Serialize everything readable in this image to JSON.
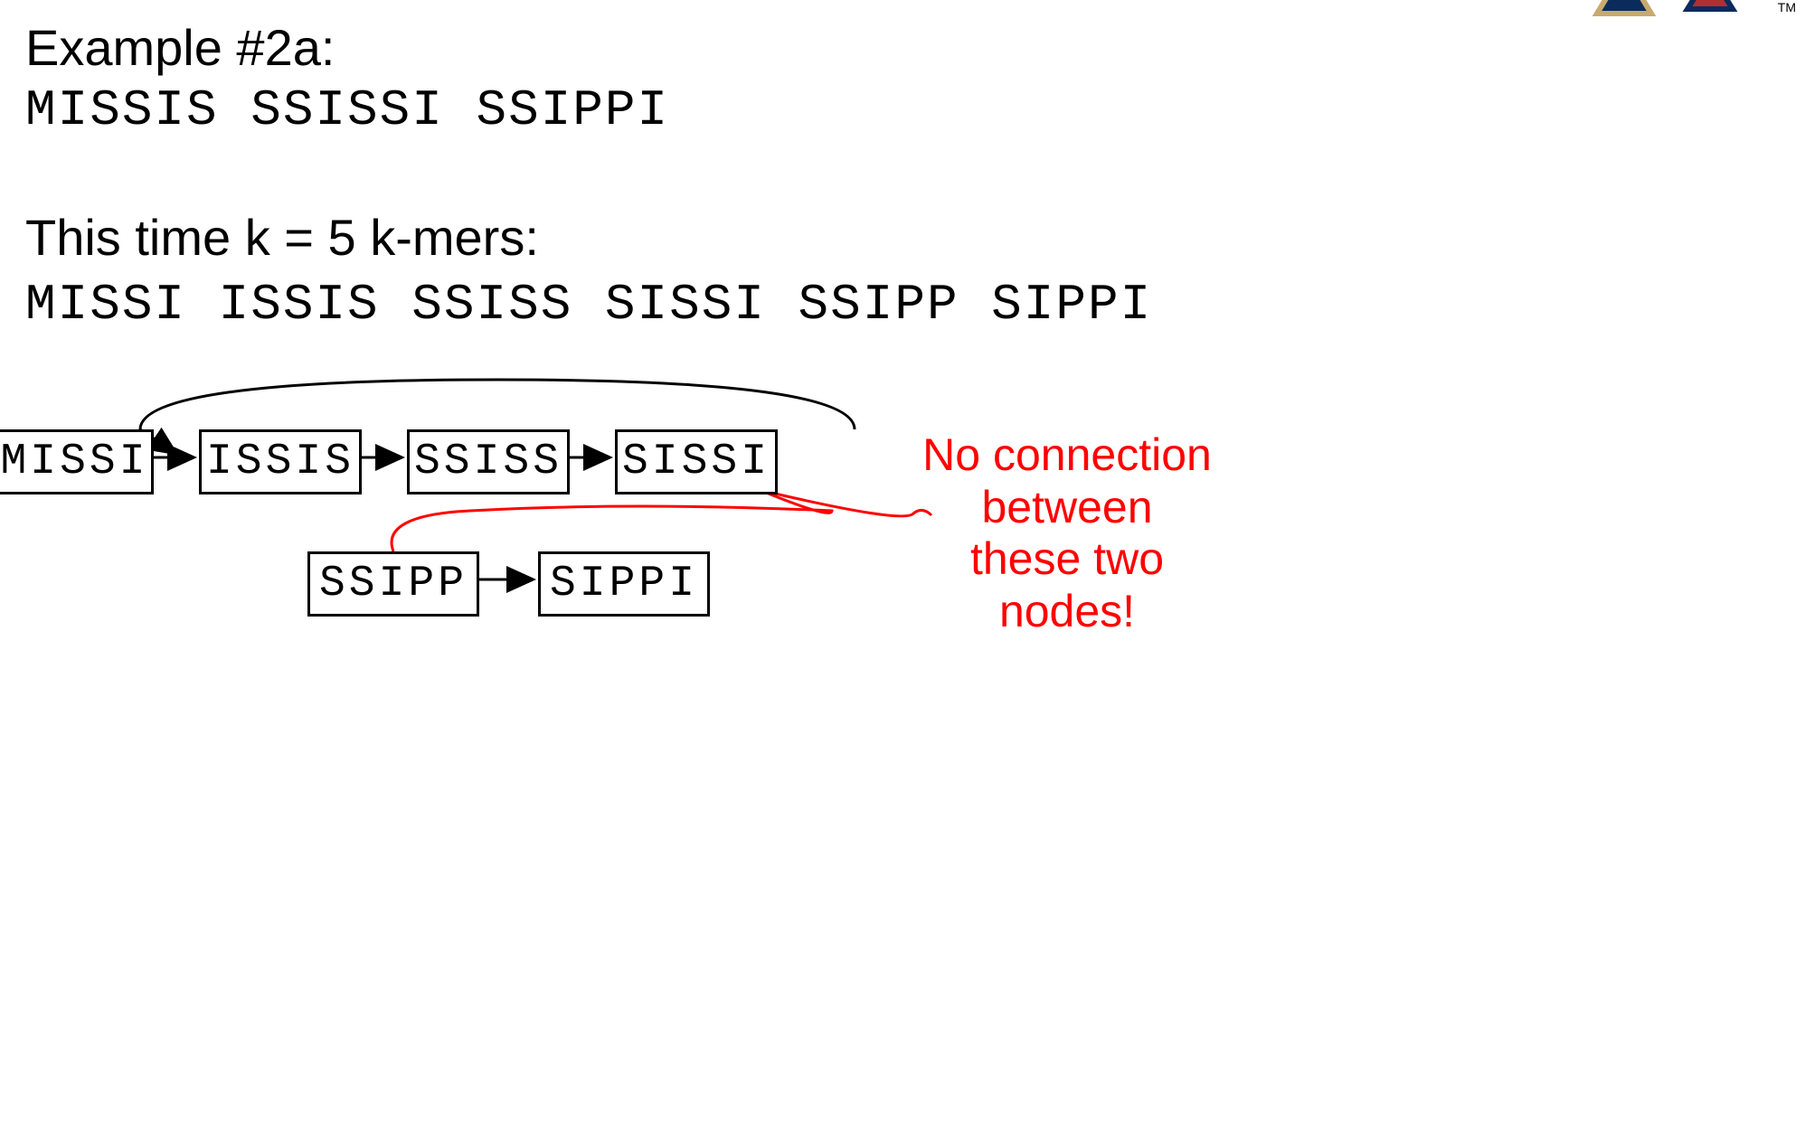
{
  "header": {
    "title": "Example #2a:",
    "sequence": "MISSIS SSISSI SSIPPI",
    "subtitle": "This time k = 5 k-mers:",
    "kmers": "MISSI ISSIS SSISS SISSI SSIPP SIPPI",
    "tm": "TM"
  },
  "nodes": {
    "n0": "MISSI",
    "n1": "ISSIS",
    "n2": "SSISS",
    "n3": "SISSI",
    "n4": "SSIPP",
    "n5": "SIPPI"
  },
  "annotation": {
    "text": "No connection between these two nodes!"
  },
  "diagram_meta": {
    "description": "De Bruijn style graph of 5-mers",
    "edges": [
      {
        "from": "MISSI",
        "to": "ISSIS"
      },
      {
        "from": "ISSIS",
        "to": "SSISS"
      },
      {
        "from": "SSISS",
        "to": "SISSI"
      },
      {
        "from": "SISSI",
        "to": "ISSIS"
      },
      {
        "from": "SSIPP",
        "to": "SIPPI"
      }
    ],
    "missing_edge": {
      "from": "SISSI",
      "to": "SSIPP",
      "note": "No connection between these two nodes!"
    }
  }
}
